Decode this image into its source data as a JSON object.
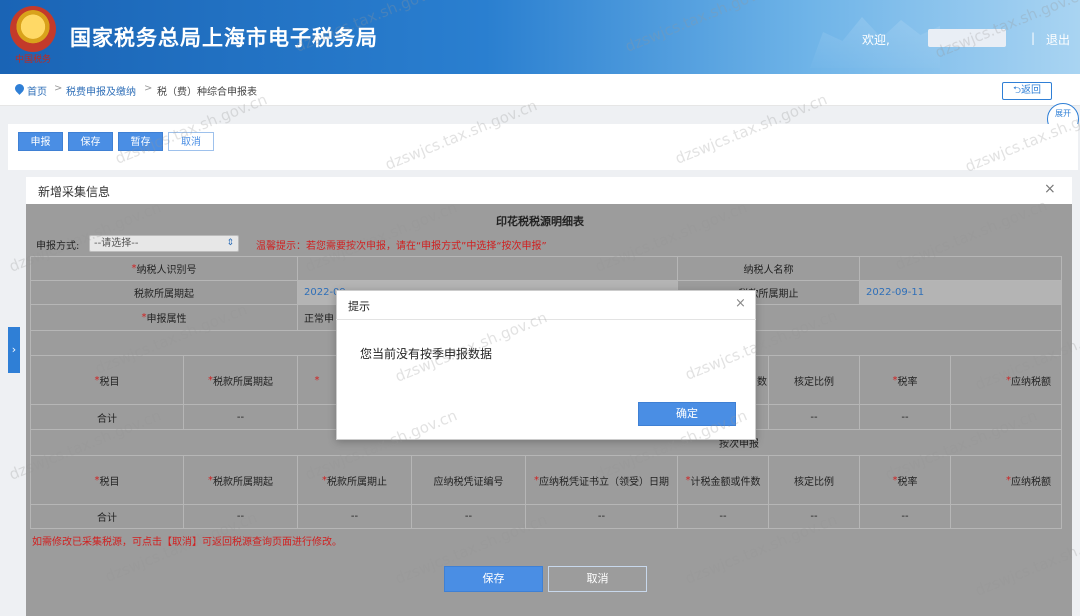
{
  "header": {
    "site_title": "国家税务总局上海市电子税务局",
    "emblem_caption": "中国税务",
    "welcome": "欢迎,",
    "separator": "|",
    "logout": "退出"
  },
  "breadcrumb": {
    "home": "首页",
    "sep": ">",
    "level1": "税费申报及缴纳",
    "current": "税（费）种综合申报表"
  },
  "back_label": "返回",
  "expand_label": "展开",
  "toolbar": {
    "declare": "申报",
    "save": "保存",
    "stage": "暂存",
    "cancel": "取消"
  },
  "modal": {
    "title": "新增采集信息",
    "close": "×"
  },
  "form": {
    "table_title": "印花税税源明细表",
    "method_label": "申报方式:",
    "method_value": "--请选择--",
    "hint": "温馨提示：若您需要按次申报，请在“申报方式”中选择“按次申报”",
    "taxpayer_id_label": "纳税人识别号",
    "taxpayer_name_label": "纳税人名称",
    "period_start_label": "税款所属期起",
    "period_start_value": "2022-09-",
    "period_end_label": "税款所属期止",
    "period_end_value": "2022-09-11",
    "attr_label": "申报属性",
    "attr_value": "正常申",
    "req_mark": "*"
  },
  "section_per_time": "按次申报",
  "table_headers": {
    "item": "税目",
    "period_start": "税款所属期起",
    "period_end": "税款所属期止",
    "voucher_no": "应纳税凭证编号",
    "voucher_date": "应纳税凭证书立（领受）日期",
    "amount": "计税金额或件数",
    "ratio": "核定比例",
    "rate": "税率",
    "tax_due": "应纳税额",
    "amount_short": "数"
  },
  "total_label": "合计",
  "dash": "--",
  "note": "如需修改已采集税源，可点击【取消】可返回税源查询页面进行修改。",
  "bottom": {
    "save": "保存",
    "cancel": "取消"
  },
  "dialog": {
    "title": "提示",
    "close": "×",
    "message": "您当前没有按季申报数据",
    "ok": "确定"
  },
  "watermark": "dzswjcs.tax.sh.gov.cn",
  "side_tab": "›"
}
